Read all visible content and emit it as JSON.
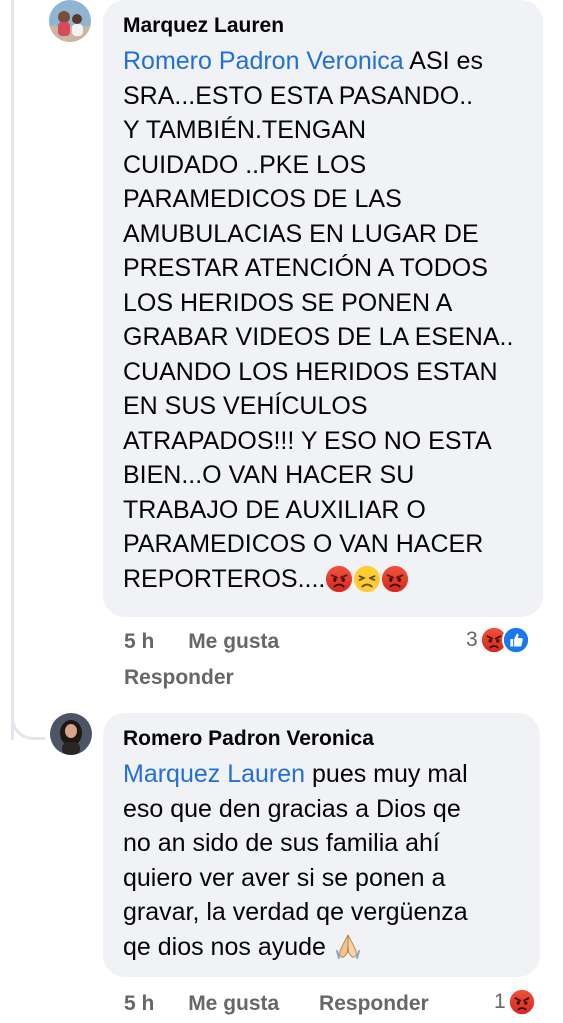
{
  "comments": [
    {
      "author": "Marquez Lauren",
      "mention": "Romero Padron Veronica",
      "text_first": "ASI es",
      "text_rest": "SRA...ESTO ESTA PASANDO..\nY TAMBIÉN.TENGAN\nCUIDADO  ..PKE LOS\nPARAMEDICOS DE LAS\nAMUBULACIAS  EN LUGAR DE\nPRESTAR ATENCIÓN  A TODOS\nLOS HERIDOS  SE PONEN A\nGRABAR VIDEOS DE LA ESENA..\nCUANDO  LOS HERIDOS ESTAN\nEN SUS VEHÍCULOS\nATRAPADOS!!! Y ESO NO ESTA\nBIEN...O VAN HACER SU\nTRABAJO DE AUXILIAR O\nPARAMEDICOS  O VAN HACER\nREPORTEROS....",
      "trailing_emojis": [
        "angry-emoji",
        "persevering-emoji",
        "angry-emoji"
      ],
      "time": "5 h",
      "like_label": "Me gusta",
      "reply_label": "Responder",
      "reaction_count": "3",
      "reaction_icons": [
        "angry-reaction-icon",
        "like-reaction-icon"
      ]
    },
    {
      "author": "Romero Padron Veronica",
      "mention": "Marquez Lauren",
      "text_first": "pues muy mal",
      "text_rest": "eso  que den gracias a Dios qe\nno an sido de sus familia ahí\nquiero ver aver si se ponen a\ngravar, la verdad qe vergüenza\nqe dios nos ayude",
      "trailing_emojis": [
        "folded-hands-emoji"
      ],
      "time": "5 h",
      "like_label": "Me gusta",
      "reply_label": "Responder",
      "reaction_count": "1",
      "reaction_icons": [
        "angry-reaction-icon"
      ]
    }
  ],
  "colors": {
    "bubble": "#f0f2f5",
    "mention": "#216fdb",
    "meta": "#65676b",
    "thread_line": "#e4e6eb",
    "angry_top": "#e9710f",
    "angry_bottom": "#d7261d",
    "like_blue": "#1877f2"
  }
}
